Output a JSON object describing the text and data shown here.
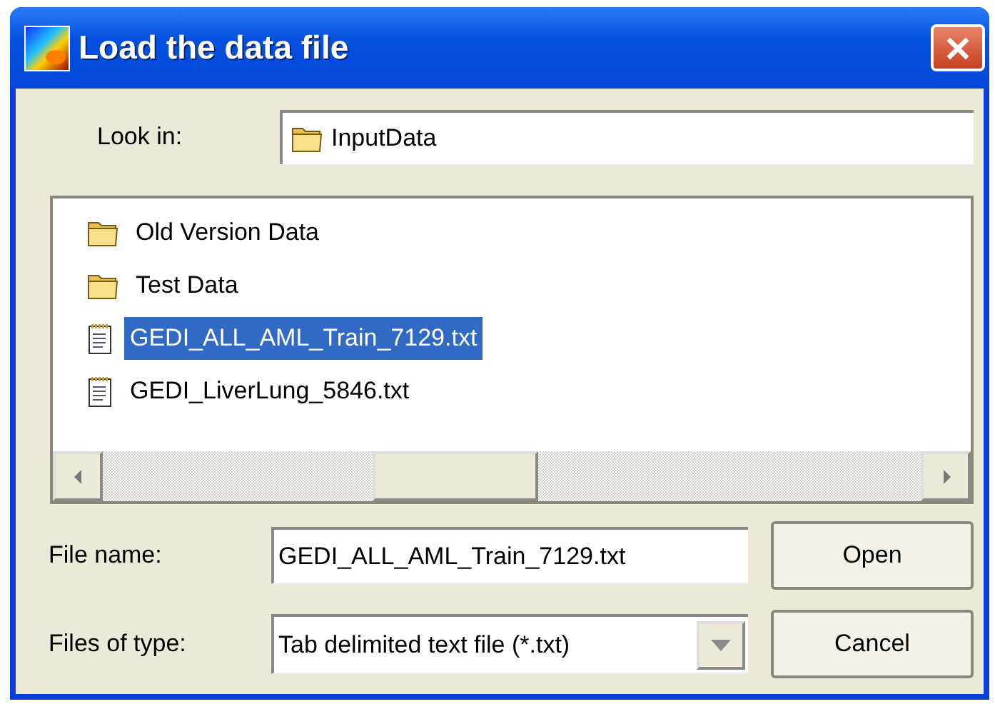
{
  "window": {
    "title": "Load the data file"
  },
  "look_in": {
    "label": "Look in:",
    "value": "InputData"
  },
  "files": [
    {
      "name": "Old Version Data",
      "kind": "folder",
      "selected": false
    },
    {
      "name": "Test Data",
      "kind": "folder",
      "selected": false
    },
    {
      "name": "GEDI_ALL_AML_Train_7129.txt",
      "kind": "file",
      "selected": true
    },
    {
      "name": "GEDI_LiverLung_5846.txt",
      "kind": "file",
      "selected": false
    }
  ],
  "file_name": {
    "label": "File name:",
    "value": "GEDI_ALL_AML_Train_7129.txt"
  },
  "file_type": {
    "label": "Files of type:",
    "value": "Tab delimited text file (*.txt)"
  },
  "buttons": [
    "Open",
    "Cancel"
  ]
}
